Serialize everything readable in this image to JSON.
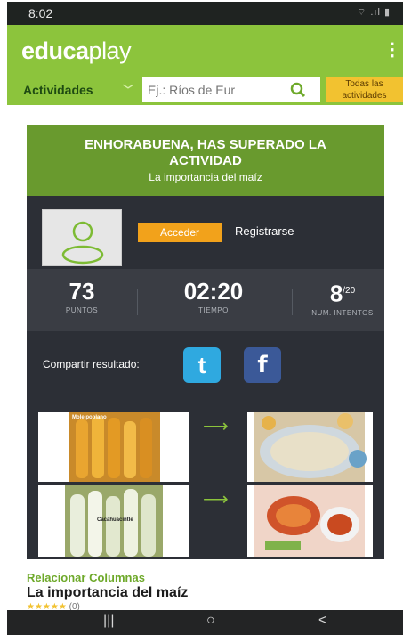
{
  "status_bar": {
    "time": "8:02",
    "system_icons": "wifi-signal-battery"
  },
  "header": {
    "logo_bold_a": "educa",
    "logo_light": "play",
    "menu_icon": "menu-dots-icon"
  },
  "search": {
    "category_label": "Actividades",
    "placeholder": "Ej.: Ríos de Eur",
    "all_activities_line1": "Todas las",
    "all_activities_line2": "actividades"
  },
  "result": {
    "title": "ENHORABUENA, HAS SUPERADO LA ACTIVIDAD",
    "subtitle": "La importancia del maíz",
    "login_label": "Acceder",
    "register_label": "Registrarse",
    "stats": [
      {
        "value": "73",
        "label": "PUNTOS"
      },
      {
        "value": "02:20",
        "label": "TIEMPO"
      },
      {
        "value": "8",
        "suffix": "/20",
        "label": "NUM. INTENTOS"
      }
    ],
    "share_label": "Compartir resultado:",
    "pairs": [
      {
        "left_caption": "Mole poblano",
        "left_image": "yellow corn cobs",
        "right_image": "tamales platter"
      },
      {
        "left_caption": "Cacahuacintle",
        "left_image": "white corn cobs",
        "right_image": "pozole bowls"
      }
    ]
  },
  "activity": {
    "type": "Relacionar Columnas",
    "title": "La importancia del maíz",
    "rating_count": "(0)"
  },
  "nav": {
    "recents": "|||",
    "home": "○",
    "back": "<"
  },
  "colors": {
    "brand_green": "#8cc43c",
    "banner_green": "#699a2e",
    "accent_orange": "#f2a21b",
    "card_dark": "#2c2f36"
  }
}
